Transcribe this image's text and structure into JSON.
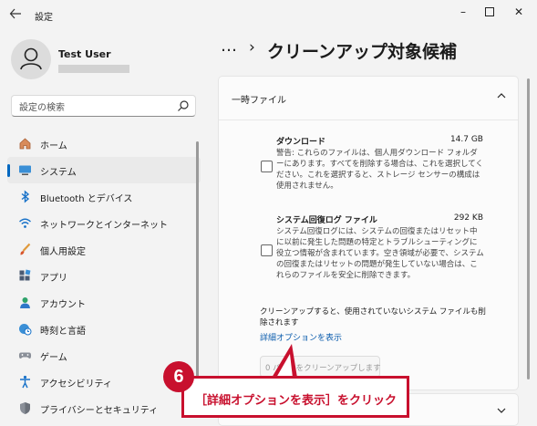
{
  "window": {
    "app_title": "設定",
    "back_icon": "back-arrow-icon",
    "minimize_glyph": "–",
    "maximize_glyph": "☐",
    "close_glyph": "✕"
  },
  "user": {
    "name": "Test User"
  },
  "search": {
    "placeholder": "設定の検索"
  },
  "sidebar": {
    "items": [
      {
        "label": "ホーム",
        "icon": "home-icon"
      },
      {
        "label": "システム",
        "icon": "monitor-icon",
        "selected": true
      },
      {
        "label": "Bluetooth とデバイス",
        "icon": "bluetooth-icon"
      },
      {
        "label": "ネットワークとインターネット",
        "icon": "wifi-icon"
      },
      {
        "label": "個人用設定",
        "icon": "brush-icon"
      },
      {
        "label": "アプリ",
        "icon": "apps-icon"
      },
      {
        "label": "アカウント",
        "icon": "account-icon"
      },
      {
        "label": "時刻と言語",
        "icon": "globe-clock-icon"
      },
      {
        "label": "ゲーム",
        "icon": "gamepad-icon"
      },
      {
        "label": "アクセシビリティ",
        "icon": "accessibility-icon"
      },
      {
        "label": "プライバシーとセキュリティ",
        "icon": "shield-icon"
      }
    ]
  },
  "header": {
    "more_label": "…",
    "separator": "›",
    "title": "クリーンアップ対象候補"
  },
  "section": {
    "title": "一時ファイル",
    "files": [
      {
        "name": "ダウンロード",
        "size": "14.7 GB",
        "checked": false,
        "description": "警告: これらのファイルは、個人用ダウンロード フォルダーにあります。すべてを削除する場合は、これを選択してください。これを選択すると、ストレージ センサーの構成は使用されません。"
      },
      {
        "name": "システム回復ログ ファイル",
        "size": "292 KB",
        "checked": false,
        "description": "システム回復ログには、システムの回復またはリセット中に以前に発生した問題の特定とトラブルシューティングに役立つ情報が含まれています。空き領域が必要で、システムの回復またはリセットの問題が発生していない場合は、これらのファイルを安全に削除できます。"
      }
    ],
    "note": "クリーンアップすると、使用されていないシステム ファイルも削除されます",
    "advanced_link": "詳細オプションを表示",
    "cleanup_button": "0 バイトをクリーンアップします"
  },
  "annotation": {
    "step": "6",
    "text": "［詳細オプションを表示］をクリック",
    "color": "#c8102e"
  },
  "colors": {
    "accent": "#0067c0",
    "link": "#0b5cad"
  }
}
